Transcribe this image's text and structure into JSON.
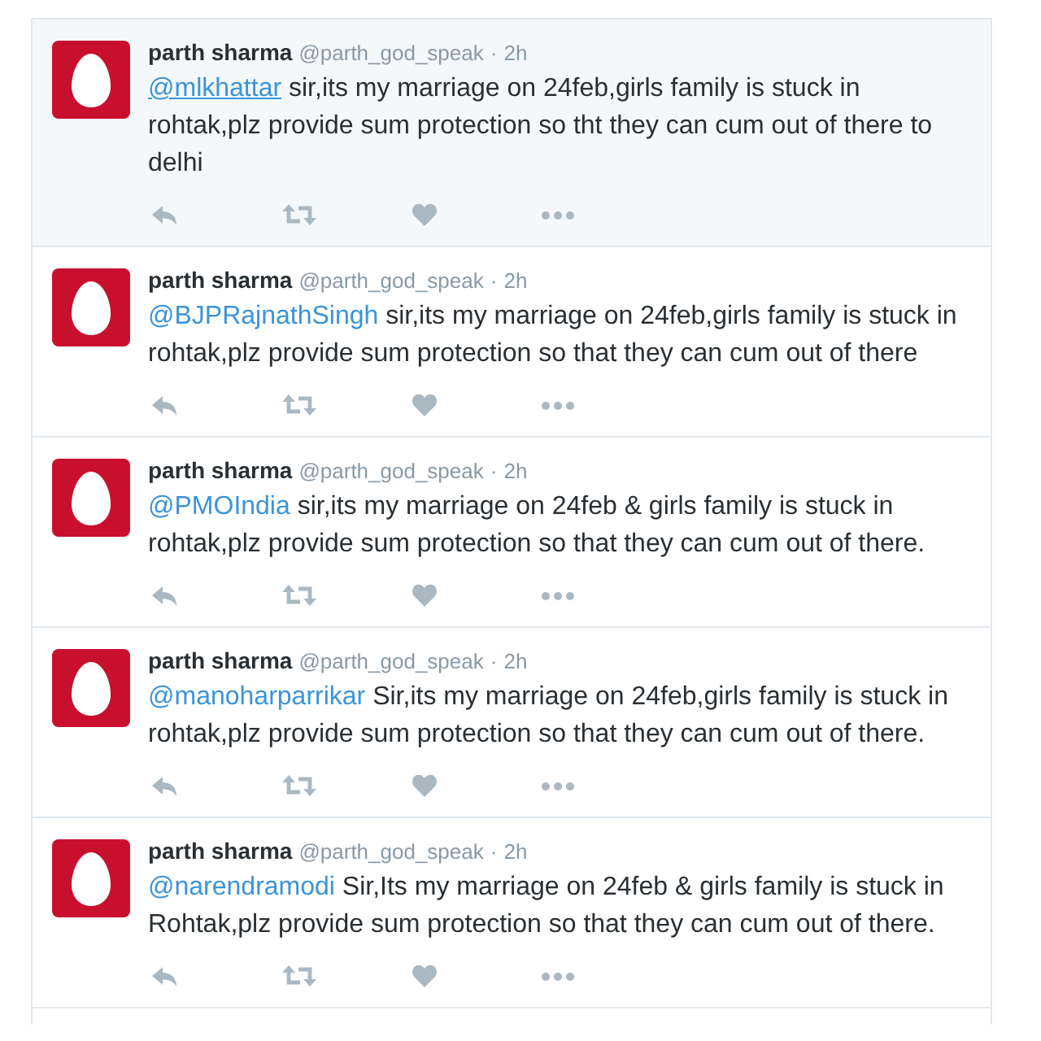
{
  "tweets": [
    {
      "name": "parth sharma",
      "handle": "@parth_god_speak",
      "separator": "·",
      "time": "2h",
      "mention": "@mlkhattar",
      "text": "sir,its my marriage on 24feb,girls family is stuck in rohtak,plz provide sum protection so tht they can cum out of there to delhi",
      "highlighted": true
    },
    {
      "name": "parth sharma",
      "handle": "@parth_god_speak",
      "separator": "·",
      "time": "2h",
      "mention": "@BJPRajnathSingh",
      "text": "sir,its my marriage on 24feb,girls family is stuck in rohtak,plz provide sum protection so that they can cum out of there",
      "highlighted": false
    },
    {
      "name": "parth sharma",
      "handle": "@parth_god_speak",
      "separator": "·",
      "time": "2h",
      "mention": "@PMOIndia",
      "text": "sir,its my marriage on 24feb & girls family is stuck in rohtak,plz provide sum protection so that they can cum out of there.",
      "highlighted": false
    },
    {
      "name": "parth sharma",
      "handle": "@parth_god_speak",
      "separator": "·",
      "time": "2h",
      "mention": "@manoharparrikar",
      "text": "Sir,its my marriage on 24feb,girls family is stuck in rohtak,plz provide sum protection so that they can cum out of there.",
      "highlighted": false
    },
    {
      "name": "parth sharma",
      "handle": "@parth_god_speak",
      "separator": "·",
      "time": "2h",
      "mention": "@narendramodi",
      "text": "Sir,Its my marriage on 24feb & girls family is stuck in Rohtak,plz provide sum protection so that they can cum out of there.",
      "highlighted": false
    }
  ]
}
